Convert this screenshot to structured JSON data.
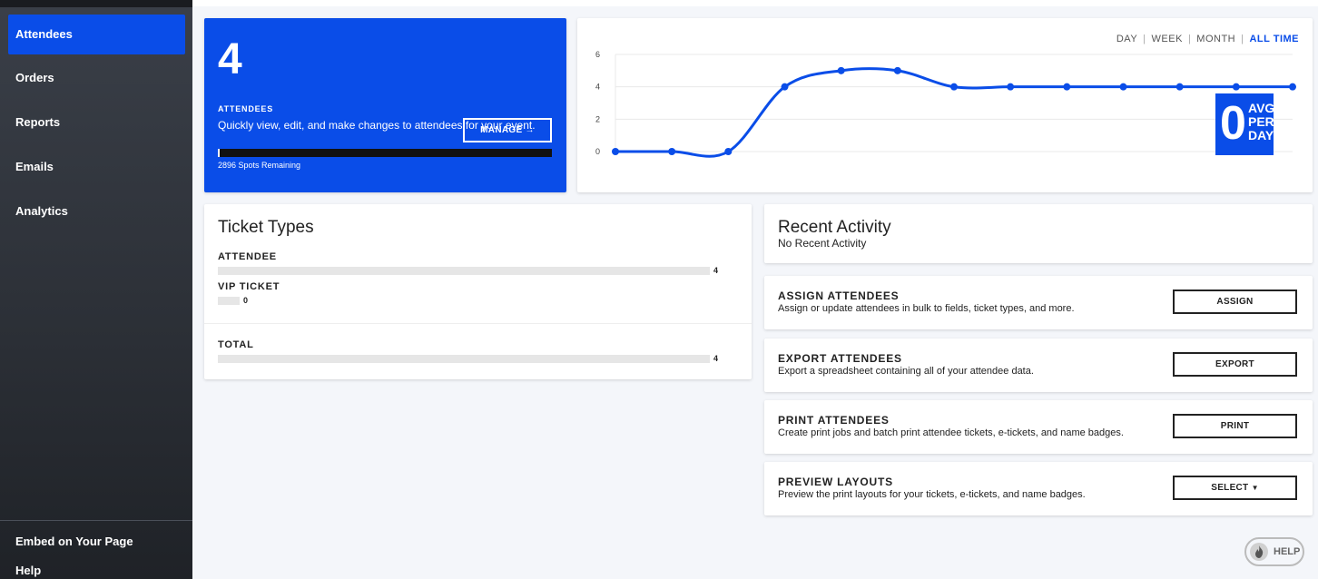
{
  "sidebar": {
    "items": [
      {
        "label": "Attendees",
        "active": true
      },
      {
        "label": "Orders"
      },
      {
        "label": "Reports"
      },
      {
        "label": "Emails"
      },
      {
        "label": "Analytics"
      }
    ],
    "footer": [
      {
        "label": "Embed on Your Page"
      },
      {
        "label": "Help"
      }
    ]
  },
  "summary": {
    "count": "4",
    "label": "ATTENDEES",
    "description": "Quickly view, edit, and make changes to attendees for your event.",
    "manage_label": "MANAGE",
    "spots_text": "2896 Spots Remaining",
    "accent": "#0a4de8"
  },
  "chart": {
    "ranges": [
      "DAY",
      "WEEK",
      "MONTH",
      "ALL TIME"
    ],
    "active_range": "ALL TIME",
    "avg_value": "0",
    "avg_label": [
      "AVG",
      "PER",
      "DAY"
    ]
  },
  "chart_data": {
    "type": "line",
    "title": "",
    "xlabel": "",
    "ylabel": "",
    "y_ticks": [
      "0",
      "2",
      "4",
      "6"
    ],
    "ylim": [
      0,
      6
    ],
    "grid": true,
    "series": [
      {
        "values": [
          0,
          0,
          0,
          4,
          5,
          5,
          4,
          4,
          4,
          4,
          4,
          4,
          4
        ]
      }
    ],
    "color": "#0a4de8"
  },
  "ticket_types": {
    "title": "Ticket Types",
    "items": [
      {
        "name": "ATTENDEE",
        "count": "4"
      },
      {
        "name": "VIP TICKET",
        "count": "0"
      }
    ],
    "total": {
      "name": "TOTAL",
      "count": "4"
    }
  },
  "recent_activity": {
    "title": "Recent Activity",
    "empty": "No Recent Activity"
  },
  "actions": [
    {
      "title": "ASSIGN ATTENDEES",
      "description": "Assign or update attendees in bulk to fields, ticket types, and more.",
      "button": "ASSIGN"
    },
    {
      "title": "EXPORT ATTENDEES",
      "description": "Export a spreadsheet containing all of your attendee data.",
      "button": "EXPORT"
    },
    {
      "title": "PRINT ATTENDEES",
      "description": "Create print jobs and batch print attendee tickets, e-tickets, and name badges.",
      "button": "PRINT"
    },
    {
      "title": "PREVIEW LAYOUTS",
      "description": "Preview the print layouts for your tickets, e-tickets, and name badges.",
      "button": "SELECT"
    }
  ],
  "help_button": {
    "label": "HELP"
  }
}
